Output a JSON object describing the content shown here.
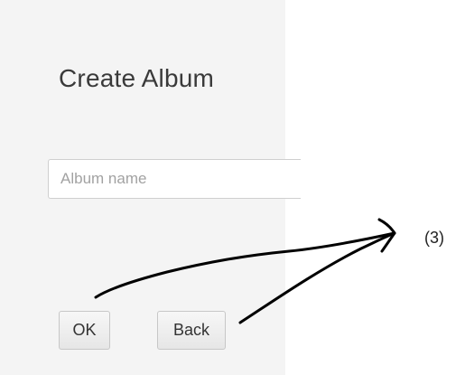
{
  "dialog": {
    "title": "Create Album",
    "album_name_placeholder": "Album name",
    "album_name_value": "",
    "ok_label": "OK",
    "back_label": "Back"
  },
  "annotation": {
    "label": "(3)",
    "stroke_color": "#000000"
  },
  "colors": {
    "panel_background": "#f4f4f4",
    "page_background": "#ffffff"
  }
}
